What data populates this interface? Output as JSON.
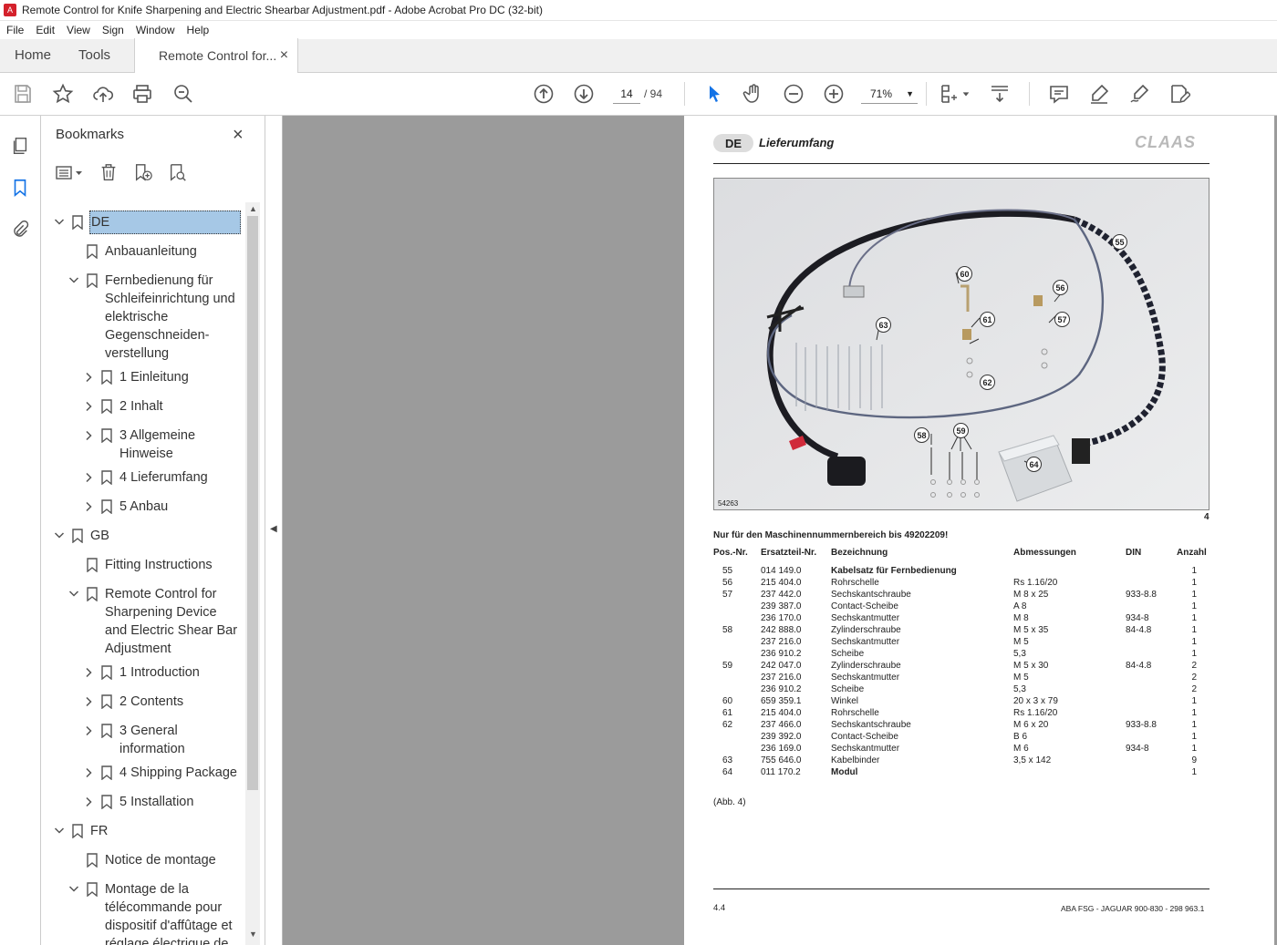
{
  "window": {
    "title": "Remote Control for Knife Sharpening and Electric Shearbar Adjustment.pdf - Adobe Acrobat Pro DC (32-bit)"
  },
  "menu": [
    "File",
    "Edit",
    "View",
    "Sign",
    "Window",
    "Help"
  ],
  "tabs": {
    "home": "Home",
    "tools": "Tools",
    "doc": "Remote Control for...",
    "close": "×"
  },
  "toolbar": {
    "page_current": "14",
    "page_total": "/ 94",
    "zoom": "71%",
    "icons": [
      "save-icon",
      "star-icon",
      "cloud-upload-icon",
      "print-icon",
      "zoom-search-icon",
      "page-up-icon",
      "page-down-icon",
      "select-cursor-icon",
      "hand-icon",
      "zoom-out-icon",
      "zoom-in-icon",
      "page-layout-icon",
      "scroll-mode-icon",
      "comment-icon",
      "highlight-icon",
      "sign-icon",
      "edit-pdf-icon"
    ]
  },
  "bookmarks": {
    "title": "Bookmarks",
    "close": "×",
    "items": [
      {
        "label": "DE",
        "level": 0,
        "expanded": true,
        "selected": true
      },
      {
        "label": "Anbauanleitung",
        "level": 1,
        "expanded": null
      },
      {
        "label": "Fernbedienung für Schleifeinrichtung und elektrische Gegenschneiden-verstellung",
        "level": 1,
        "expanded": true
      },
      {
        "label": "1 Einleitung",
        "level": 2,
        "expanded": false
      },
      {
        "label": "2 Inhalt",
        "level": 2,
        "expanded": false
      },
      {
        "label": "3 Allgemeine Hinweise",
        "level": 2,
        "expanded": false
      },
      {
        "label": "4 Lieferumfang",
        "level": 2,
        "expanded": false
      },
      {
        "label": "5 Anbau",
        "level": 2,
        "expanded": false
      },
      {
        "label": "GB",
        "level": 0,
        "expanded": true
      },
      {
        "label": "Fitting Instructions",
        "level": 1,
        "expanded": null
      },
      {
        "label": "Remote Control for Sharpening Device and Electric Shear Bar Adjustment",
        "level": 1,
        "expanded": true
      },
      {
        "label": "1 Introduction",
        "level": 2,
        "expanded": false
      },
      {
        "label": "2 Contents",
        "level": 2,
        "expanded": false
      },
      {
        "label": "3 General information",
        "level": 2,
        "expanded": false
      },
      {
        "label": "4 Shipping Package",
        "level": 2,
        "expanded": false
      },
      {
        "label": "5 Installation",
        "level": 2,
        "expanded": false
      },
      {
        "label": "FR",
        "level": 0,
        "expanded": true
      },
      {
        "label": "Notice de montage",
        "level": 1,
        "expanded": null
      },
      {
        "label": "Montage de la télécommande pour dispositif d'affûtage et réglage électrique de",
        "level": 1,
        "expanded": true
      }
    ]
  },
  "page": {
    "lang": "DE",
    "section": "Lieferumfang",
    "brand": "CLAAS",
    "photo_id": "54263",
    "figure_number": "4",
    "callouts": [
      "55",
      "56",
      "57",
      "58",
      "59",
      "60",
      "61",
      "62",
      "63",
      "64"
    ],
    "note": "Nur für den Maschinennummernbereich bis 49202209!",
    "headers": [
      "Pos.-Nr.",
      "Ersatzteil-Nr.",
      "Bezeichnung",
      "Abmessungen",
      "DIN",
      "Anzahl"
    ],
    "rows": [
      [
        "55",
        "014 149.0",
        "Kabelsatz für Fernbedienung",
        "",
        "",
        "1",
        true
      ],
      [
        "56",
        "215 404.0",
        "Rohrschelle",
        "Rs 1.16/20",
        "",
        "1",
        false
      ],
      [
        "57",
        "237 442.0",
        "Sechskantschraube",
        "M 8 x 25",
        "933-8.8",
        "1",
        false
      ],
      [
        "",
        "239 387.0",
        "Contact-Scheibe",
        "A 8",
        "",
        "1",
        false
      ],
      [
        "",
        "236 170.0",
        "Sechskantmutter",
        "M 8",
        "934-8",
        "1",
        false
      ],
      [
        "58",
        "242 888.0",
        "Zylinderschraube",
        "M 5 x 35",
        "84-4.8",
        "1",
        false
      ],
      [
        "",
        "237 216.0",
        "Sechskantmutter",
        "M 5",
        "",
        "1",
        false
      ],
      [
        "",
        "236 910.2",
        "Scheibe",
        "5,3",
        "",
        "1",
        false
      ],
      [
        "59",
        "242 047.0",
        "Zylinderschraube",
        "M 5 x 30",
        "84-4.8",
        "2",
        false
      ],
      [
        "",
        "237 216.0",
        "Sechskantmutter",
        "M 5",
        "",
        "2",
        false
      ],
      [
        "",
        "236 910.2",
        "Scheibe",
        "5,3",
        "",
        "2",
        false
      ],
      [
        "60",
        "659 359.1",
        "Winkel",
        "20 x 3 x 79",
        "",
        "1",
        false
      ],
      [
        "61",
        "215 404.0",
        "Rohrschelle",
        "Rs 1.16/20",
        "",
        "1",
        false
      ],
      [
        "62",
        "237 466.0",
        "Sechskantschraube",
        "M 6 x 20",
        "933-8.8",
        "1",
        false
      ],
      [
        "",
        "239 392.0",
        "Contact-Scheibe",
        "B 6",
        "",
        "1",
        false
      ],
      [
        "",
        "236 169.0",
        "Sechskantmutter",
        "M 6",
        "934-8",
        "1",
        false
      ],
      [
        "63",
        "755 646.0",
        "Kabelbinder",
        "3,5 x 142",
        "",
        "9",
        false
      ],
      [
        "64",
        "011 170.2",
        "Modul",
        "",
        "",
        "1",
        true
      ]
    ],
    "abb": "(Abb. 4)",
    "footer_num": "4.4",
    "footer_ref": "ABA FSG - JAGUAR 900-830 - 298 963.1"
  }
}
